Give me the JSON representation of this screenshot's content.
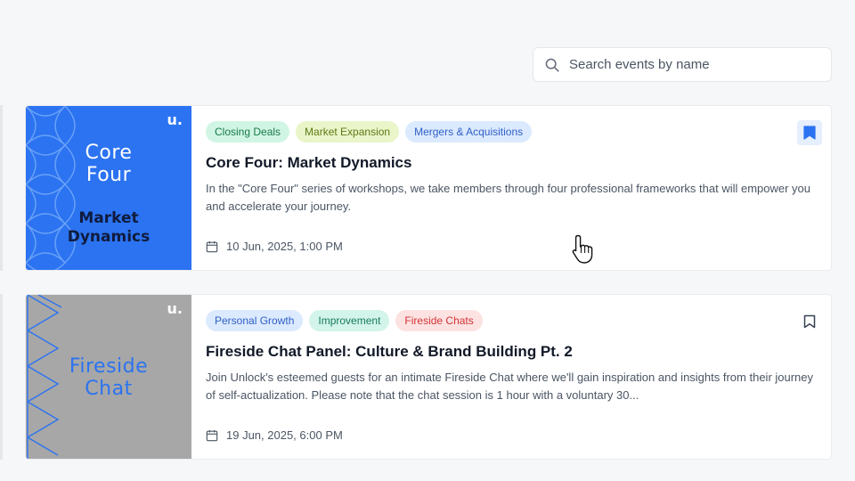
{
  "search": {
    "placeholder": "Search events by name",
    "icon": "search-icon"
  },
  "colors": {
    "accent": "#2b73f1",
    "thumb_grey": "#a7a7a7"
  },
  "events": [
    {
      "thumbnail": {
        "brand": "u.",
        "line1": "Core Four",
        "line2": "Market Dynamics"
      },
      "tags": [
        "Closing Deals",
        "Market Expansion",
        "Mergers & Acquisitions"
      ],
      "title": "Core Four: Market Dynamics",
      "description": "In the \"Core Four\" series of workshops, we take members through four professional frameworks that will empower you and accelerate your journey.",
      "date": "10 Jun, 2025, 1:00 PM",
      "bookmarked": true
    },
    {
      "thumbnail": {
        "brand": "u.",
        "line1": "Fireside Chat"
      },
      "tags": [
        "Personal Growth",
        "Improvement",
        "Fireside Chats"
      ],
      "title": "Fireside Chat Panel: Culture & Brand Building Pt. 2",
      "description": "Join Unlock's esteemed guests for an intimate Fireside Chat where we'll gain inspiration and insights from their journey of self-actualization. Please note that the chat session is 1 hour with a voluntary 30...",
      "date": "19 Jun, 2025, 6:00 PM",
      "bookmarked": false
    }
  ]
}
